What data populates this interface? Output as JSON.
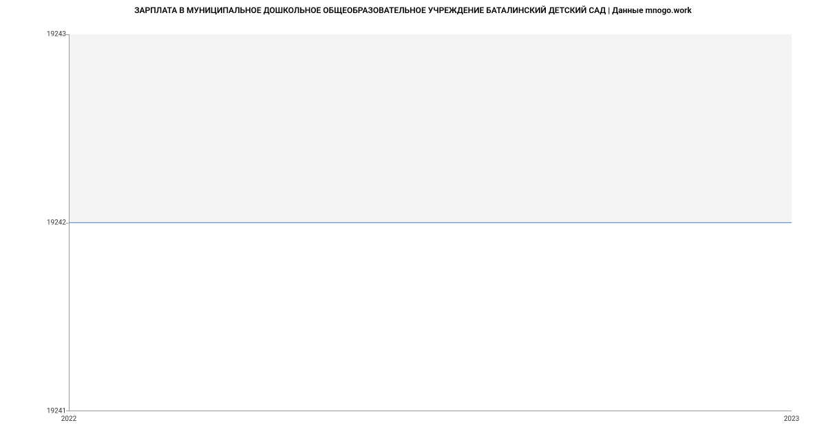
{
  "chart_data": {
    "type": "line",
    "title": "ЗАРПЛАТА В МУНИЦИПАЛЬНОЕ ДОШКОЛЬНОЕ ОБЩЕОБРАЗОВАТЕЛЬНОЕ УЧРЕЖДЕНИЕ БАТАЛИНСКИЙ ДЕТСКИЙ САД | Данные mnogo.work",
    "x": [
      2022,
      2023
    ],
    "series": [
      {
        "name": "salary",
        "values": [
          19242,
          19242
        ],
        "color": "#4a7ec8"
      }
    ],
    "xlabel": "",
    "ylabel": "",
    "ylim": [
      19241,
      19243
    ],
    "y_ticks": [
      19241,
      19242,
      19243
    ],
    "x_ticks": [
      2022,
      2023
    ]
  }
}
